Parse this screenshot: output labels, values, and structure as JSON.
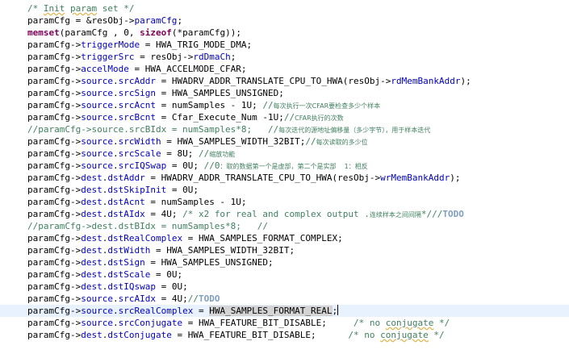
{
  "editor": {
    "current_line": 25,
    "lines": [
      {
        "indent": "",
        "tokens": [
          {
            "t": "/* ",
            "c": "cm"
          },
          {
            "t": "Init",
            "c": "cm",
            "sq": true
          },
          {
            "t": " ",
            "c": "cm"
          },
          {
            "t": "param",
            "c": "cm",
            "sq": true
          },
          {
            "t": " set */",
            "c": "cm"
          }
        ]
      },
      {
        "indent": "",
        "tokens": [
          {
            "t": "paramCfg = &resObj->"
          },
          {
            "t": "paramCfg",
            "c": "field"
          },
          {
            "t": ";"
          }
        ]
      },
      {
        "indent": "",
        "tokens": [
          {
            "t": "memset",
            "c": "fn"
          },
          {
            "t": "(paramCfg , 0, "
          },
          {
            "t": "sizeof",
            "c": "kw"
          },
          {
            "t": "(*paramCfg));"
          }
        ]
      },
      {
        "indent": "",
        "tokens": [
          {
            "t": "paramCfg->"
          },
          {
            "t": "triggerMode",
            "c": "field"
          },
          {
            "t": " = HWA_TRIG_MODE_DMA;"
          }
        ]
      },
      {
        "indent": "",
        "tokens": [
          {
            "t": "paramCfg->"
          },
          {
            "t": "triggerSrc",
            "c": "field"
          },
          {
            "t": " = resObj->"
          },
          {
            "t": "rdDmaCh",
            "c": "field"
          },
          {
            "t": ";"
          }
        ]
      },
      {
        "indent": "",
        "tokens": [
          {
            "t": "paramCfg->"
          },
          {
            "t": "accelMode",
            "c": "field"
          },
          {
            "t": " = HWA_ACCELMODE_CFAR;"
          }
        ]
      },
      {
        "indent": "",
        "tokens": [
          {
            "t": "paramCfg->"
          },
          {
            "t": "source",
            "c": "field"
          },
          {
            "t": "."
          },
          {
            "t": "srcAddr",
            "c": "field"
          },
          {
            "t": " = HWADRV_ADDR_TRANSLATE_CPU_TO_HWA(resObj->"
          },
          {
            "t": "rdMemBankAddr",
            "c": "field"
          },
          {
            "t": ");"
          }
        ]
      },
      {
        "indent": "",
        "tokens": [
          {
            "t": "paramCfg->"
          },
          {
            "t": "source",
            "c": "field"
          },
          {
            "t": "."
          },
          {
            "t": "srcSign",
            "c": "field"
          },
          {
            "t": " = HWA_SAMPLES_UNSIGNED;"
          }
        ]
      },
      {
        "indent": "",
        "tokens": [
          {
            "t": "paramCfg->"
          },
          {
            "t": "source",
            "c": "field"
          },
          {
            "t": "."
          },
          {
            "t": "srcAcnt",
            "c": "field"
          },
          {
            "t": " = numSamples - 1U; "
          },
          {
            "t": "//",
            "c": "cm"
          },
          {
            "t": "每次执行一次CFAR要检查多少个样本",
            "c": "cn"
          }
        ]
      },
      {
        "indent": "",
        "tokens": [
          {
            "t": "paramCfg->"
          },
          {
            "t": "source",
            "c": "field"
          },
          {
            "t": "."
          },
          {
            "t": "srcBcnt",
            "c": "field"
          },
          {
            "t": " = Cfar_Execute_Num -1U;"
          },
          {
            "t": "//",
            "c": "cm"
          },
          {
            "t": "CFAR执行的次数",
            "c": "cn"
          }
        ]
      },
      {
        "indent": "",
        "tokens": [
          {
            "t": "//paramCfg->source.srcBIdx = numSamples*8;   //",
            "c": "cm"
          },
          {
            "t": "每次迭代的源地址偏移量（多少字节），用于样本迭代",
            "c": "cn"
          }
        ]
      },
      {
        "indent": "",
        "tokens": [
          {
            "t": "paramCfg->"
          },
          {
            "t": "source",
            "c": "field"
          },
          {
            "t": "."
          },
          {
            "t": "srcWidth",
            "c": "field"
          },
          {
            "t": " = HWA_SAMPLES_WIDTH_32BIT;"
          },
          {
            "t": "//",
            "c": "cm"
          },
          {
            "t": "每次读取的多少位",
            "c": "cn"
          }
        ]
      },
      {
        "indent": "",
        "tokens": [
          {
            "t": "paramCfg->"
          },
          {
            "t": "source",
            "c": "field"
          },
          {
            "t": "."
          },
          {
            "t": "srcScale",
            "c": "field"
          },
          {
            "t": " = 8U; "
          },
          {
            "t": "//",
            "c": "cm"
          },
          {
            "t": "缩放功能",
            "c": "cn"
          }
        ]
      },
      {
        "indent": "",
        "tokens": [
          {
            "t": "paramCfg->"
          },
          {
            "t": "source",
            "c": "field"
          },
          {
            "t": "."
          },
          {
            "t": "srcIQSwap",
            "c": "field"
          },
          {
            "t": " = 0U; "
          },
          {
            "t": "//0",
            "c": "cm"
          },
          {
            "t": "：取的数据第一个是虚部，第二个是实部    1：相反",
            "c": "cn"
          }
        ]
      },
      {
        "indent": "",
        "tokens": [
          {
            "t": "paramCfg->"
          },
          {
            "t": "dest",
            "c": "field"
          },
          {
            "t": "."
          },
          {
            "t": "dstAddr",
            "c": "field"
          },
          {
            "t": " = HWADRV_ADDR_TRANSLATE_CPU_TO_HWA(resObj->"
          },
          {
            "t": "wrMemBankAddr",
            "c": "field"
          },
          {
            "t": ");"
          }
        ]
      },
      {
        "indent": "",
        "tokens": [
          {
            "t": "paramCfg->"
          },
          {
            "t": "dest",
            "c": "field"
          },
          {
            "t": "."
          },
          {
            "t": "dstSkipInit",
            "c": "field"
          },
          {
            "t": " = 0U;"
          }
        ]
      },
      {
        "indent": "",
        "tokens": [
          {
            "t": "paramCfg->"
          },
          {
            "t": "dest",
            "c": "field"
          },
          {
            "t": "."
          },
          {
            "t": "dstAcnt",
            "c": "field"
          },
          {
            "t": " = numSamples - 1U;"
          }
        ]
      },
      {
        "indent": "",
        "tokens": [
          {
            "t": "paramCfg->"
          },
          {
            "t": "dest",
            "c": "field"
          },
          {
            "t": "."
          },
          {
            "t": "dstAIdx",
            "c": "field"
          },
          {
            "t": " = 4U; "
          },
          {
            "t": "/* x2 for real and complex output .",
            "c": "cm"
          },
          {
            "t": "连续样本之间间隔",
            "c": "cn"
          },
          {
            "t": "*///",
            "c": "cm"
          },
          {
            "t": "TODO",
            "c": "todo"
          }
        ]
      },
      {
        "indent": "",
        "tokens": [
          {
            "t": "//paramCfg->dest.dstBIdx = numSamples*8;   //",
            "c": "cm"
          }
        ]
      },
      {
        "indent": "",
        "tokens": [
          {
            "t": "paramCfg->"
          },
          {
            "t": "dest",
            "c": "field"
          },
          {
            "t": "."
          },
          {
            "t": "dstRealComplex",
            "c": "field"
          },
          {
            "t": " = HWA_SAMPLES_FORMAT_COMPLEX;"
          }
        ]
      },
      {
        "indent": "",
        "tokens": [
          {
            "t": "paramCfg->"
          },
          {
            "t": "dest",
            "c": "field"
          },
          {
            "t": "."
          },
          {
            "t": "dstWidth",
            "c": "field"
          },
          {
            "t": " = HWA_SAMPLES_WIDTH_32BIT;"
          }
        ]
      },
      {
        "indent": "",
        "tokens": [
          {
            "t": "paramCfg->"
          },
          {
            "t": "dest",
            "c": "field"
          },
          {
            "t": "."
          },
          {
            "t": "dstSign",
            "c": "field"
          },
          {
            "t": " = HWA_SAMPLES_UNSIGNED;"
          }
        ]
      },
      {
        "indent": "",
        "tokens": [
          {
            "t": "paramCfg->"
          },
          {
            "t": "dest",
            "c": "field"
          },
          {
            "t": "."
          },
          {
            "t": "dstScale",
            "c": "field"
          },
          {
            "t": " = 0U;"
          }
        ]
      },
      {
        "indent": "",
        "tokens": [
          {
            "t": "paramCfg->"
          },
          {
            "t": "dest",
            "c": "field"
          },
          {
            "t": "."
          },
          {
            "t": "dstIQswap",
            "c": "field"
          },
          {
            "t": " = 0U;"
          }
        ]
      },
      {
        "indent": "",
        "tokens": [
          {
            "t": "paramCfg->"
          },
          {
            "t": "source",
            "c": "field"
          },
          {
            "t": "."
          },
          {
            "t": "srcAIdx",
            "c": "field"
          },
          {
            "t": " = 4U;"
          },
          {
            "t": "//",
            "c": "cm"
          },
          {
            "t": "TODO",
            "c": "todo"
          }
        ]
      },
      {
        "indent": "",
        "tokens": [
          {
            "t": "paramCfg->"
          },
          {
            "t": "source",
            "c": "field"
          },
          {
            "t": "."
          },
          {
            "t": "srcRealComplex",
            "c": "field"
          },
          {
            "t": " = "
          },
          {
            "t": "HWA_SAMPLES_FORMAT_REAL",
            "c": "sel"
          },
          {
            "t": ";"
          },
          {
            "caret": true
          }
        ]
      },
      {
        "indent": "",
        "tokens": [
          {
            "t": "paramCfg->"
          },
          {
            "t": "source",
            "c": "field"
          },
          {
            "t": "."
          },
          {
            "t": "srcConjugate",
            "c": "field"
          },
          {
            "t": " = HWA_FEATURE_BIT_DISABLE;     "
          },
          {
            "t": "/* no ",
            "c": "cm"
          },
          {
            "t": "conjugate",
            "c": "cm",
            "sq": true
          },
          {
            "t": " */",
            "c": "cm"
          }
        ]
      },
      {
        "indent": "",
        "tokens": [
          {
            "t": "paramCfg->"
          },
          {
            "t": "dest",
            "c": "field"
          },
          {
            "t": "."
          },
          {
            "t": "dstConjugate",
            "c": "field"
          },
          {
            "t": " = HWA_FEATURE_BIT_DISABLE;      "
          },
          {
            "t": "/* no ",
            "c": "cm"
          },
          {
            "t": "conjugate",
            "c": "cm",
            "sq": true
          },
          {
            "t": " */",
            "c": "cm"
          }
        ]
      }
    ]
  }
}
